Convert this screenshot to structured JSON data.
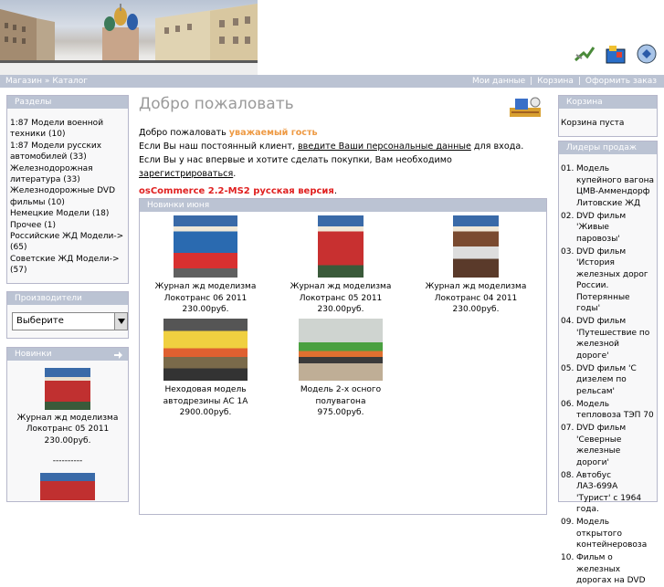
{
  "breadcrumb": {
    "home": "Магазин",
    "sep": "»",
    "catalog": "Каталог"
  },
  "topnav": {
    "account": "Мои данные",
    "cart": "Корзина",
    "checkout": "Оформить заказ"
  },
  "categories": {
    "title": "Разделы",
    "items": [
      "1:87 Модели военной техники (10)",
      "1:87 Модели русских автомобилей (33)",
      "Железнодорожная литература (33)",
      "Железнодорожные DVD фильмы (10)",
      "Немецкие Модели (18)",
      "Прочее (1)",
      "Российские ЖД Модели-> (65)",
      "Советские ЖД Модели-> (57)"
    ]
  },
  "manufacturers": {
    "title": "Производители",
    "selected": "Выберите"
  },
  "whatsnew": {
    "title": "Новинки",
    "name1": "Журнал жд моделизма",
    "name2": "Локотранс 05 2011",
    "price": "230.00руб.",
    "divider": "----------"
  },
  "main": {
    "title": "Добро пожаловать",
    "greet_prefix": "Добро пожаловать",
    "guest": "уважаемый гость",
    "line2_a": "Если Вы наш постоянный клиент,",
    "line2_link": "введите Ваши персональные данные",
    "line2_b": "для входа. Если Вы у нас впервые и хотите сделать покупки, Вам необходимо",
    "line2_link2": "зарегистрироваться",
    "line2_end": ".",
    "version": "osCommerce 2.2-MS2 русская версия",
    "version_end": "."
  },
  "new_products": {
    "title": "Новинки июня",
    "items": [
      {
        "name1": "Журнал жд моделизма",
        "name2": "Локотранс 06 2011",
        "price": "230.00руб."
      },
      {
        "name1": "Журнал жд моделизма",
        "name2": "Локотранс 05 2011",
        "price": "230.00руб."
      },
      {
        "name1": "Журнал жд моделизма",
        "name2": "Локотранс 04 2011",
        "price": "230.00руб."
      },
      {
        "name1": "Неходовая модель",
        "name2": "автодрезины АС 1А",
        "price": "2900.00руб."
      },
      {
        "name1": "Модель 2-х осного полувагона",
        "name2": "",
        "price": "975.00руб."
      }
    ]
  },
  "cart": {
    "title": "Корзина",
    "empty": "Корзина пуста"
  },
  "bestsellers": {
    "title": "Лидеры продаж",
    "items": [
      {
        "n": "01.",
        "text": "Модель купейного вагона ЦМВ-Аммендорф Литовские ЖД"
      },
      {
        "n": "02.",
        "text": "DVD фильм 'Живые паровозы'"
      },
      {
        "n": "03.",
        "text": "DVD фильм 'История железных дорог России. Потерянные годы'"
      },
      {
        "n": "04.",
        "text": "DVD фильм 'Путешествие по железной дороге'"
      },
      {
        "n": "05.",
        "text": "DVD фильм 'С дизелем по рельсам'"
      },
      {
        "n": "06.",
        "text": "Модель тепловоза ТЭП 70"
      },
      {
        "n": "07.",
        "text": "DVD фильм 'Северные железные дороги'"
      },
      {
        "n": "08.",
        "text": "Автобус ЛАЗ-699А 'Турист' с 1964 года."
      },
      {
        "n": "09.",
        "text": "Модель открытого контейнеровоза"
      },
      {
        "n": "10.",
        "text": "Фильм о железных дорогах на DVD"
      }
    ]
  },
  "colors": {
    "header_bar": "#bbc3d3",
    "border": "#b6b7cb",
    "title_gray": "#9a9a9a",
    "guest_orange": "#ee9a44",
    "version_red": "#e02020"
  }
}
